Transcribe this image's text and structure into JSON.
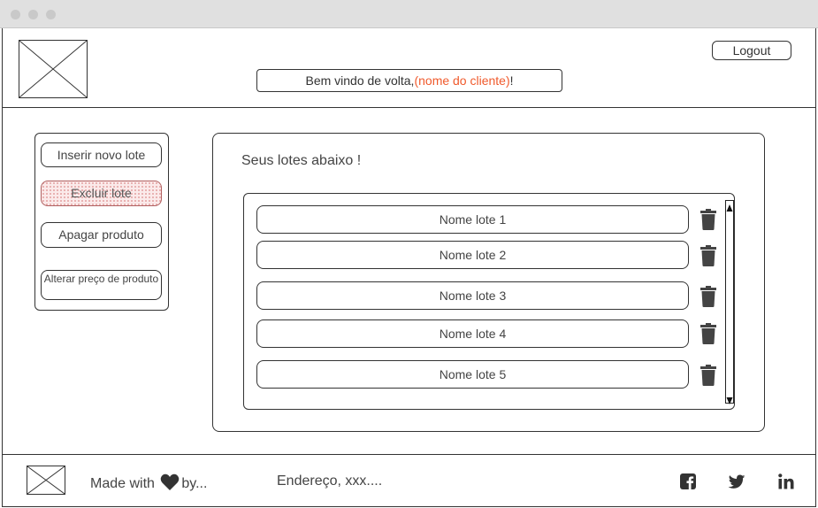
{
  "header": {
    "welcome_prefix": "Bem vindo de volta,",
    "welcome_client": "(nome do cliente)",
    "welcome_suffix": "!",
    "logout_label": "Logout"
  },
  "sidebar": {
    "items": [
      {
        "label": "Inserir novo lote"
      },
      {
        "label": "Excluir lote",
        "active": true
      },
      {
        "label": "Apagar produto"
      },
      {
        "label": "Alterar preço de produto"
      }
    ]
  },
  "main": {
    "title": "Seus lotes abaixo !",
    "lots": [
      {
        "name": "Nome lote 1"
      },
      {
        "name": "Nome lote 2"
      },
      {
        "name": "Nome lote 3"
      },
      {
        "name": "Nome lote 4"
      },
      {
        "name": "Nome lote 5"
      }
    ]
  },
  "footer": {
    "made_with": "Made with",
    "by": "by...",
    "address": "Endereço, xxx....",
    "social": [
      "facebook-icon",
      "twitter-icon",
      "linkedin-icon"
    ]
  },
  "colors": {
    "accent": "#f05a2c",
    "active_fill": "#fbeaea",
    "line": "#333333"
  }
}
